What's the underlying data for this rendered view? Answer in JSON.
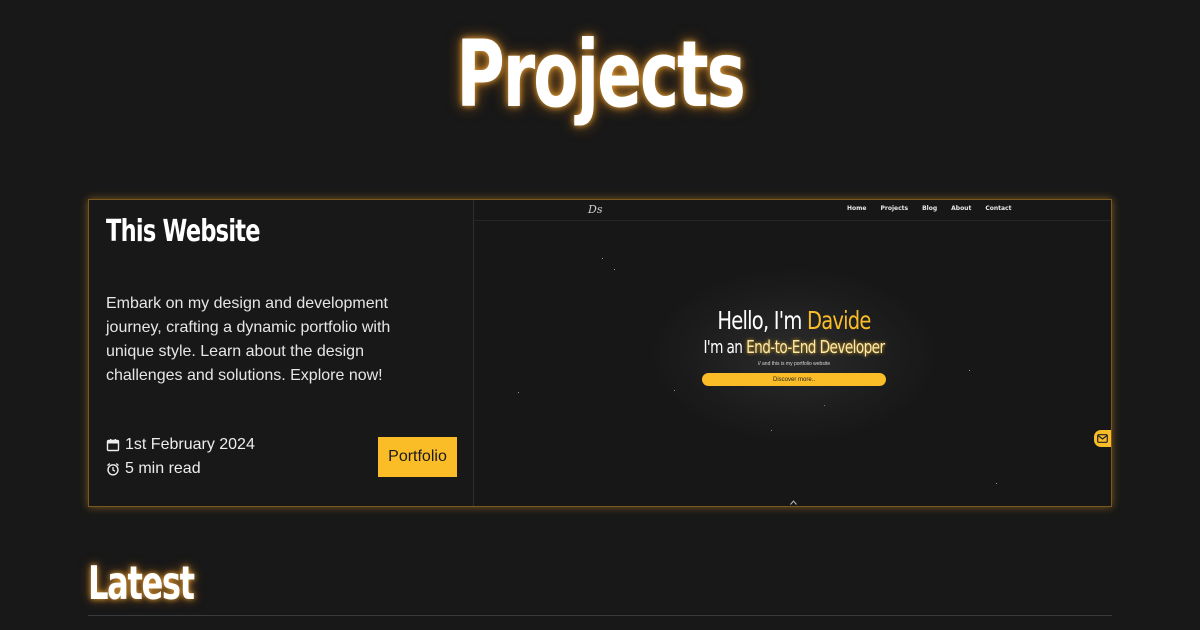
{
  "page": {
    "title": "Projects"
  },
  "project_card": {
    "title": "This Website",
    "description": "Embark on my design and development journey, crafting a dynamic portfolio with unique style. Learn about the design challenges and solutions. Explore now!",
    "date": "1st February 2024",
    "read_time": "5 min read",
    "tag_label": "Portfolio",
    "preview": {
      "logo_text": "Ds",
      "nav_links": [
        "Home",
        "Projects",
        "Blog",
        "About",
        "Contact"
      ],
      "hero_line1_prefix": "Hello, I'm ",
      "hero_line1_accent": "Davide",
      "hero_line2_prefix": "I'm an ",
      "hero_line2_accent": "End-to-End Developer",
      "hero_sub": "// and this is my portfolio website",
      "hero_button": "Discover more..",
      "icons": [
        "mail-icon",
        "chevron-up-icon"
      ]
    }
  },
  "latest": {
    "heading": "Latest"
  },
  "colors": {
    "background": "#181818",
    "accent": "#fbbd27",
    "glow": "#ffb43c",
    "card_border": "#7a5a1c"
  },
  "icons": {
    "date": "calendar-icon",
    "read_time": "alarm-clock-icon"
  }
}
